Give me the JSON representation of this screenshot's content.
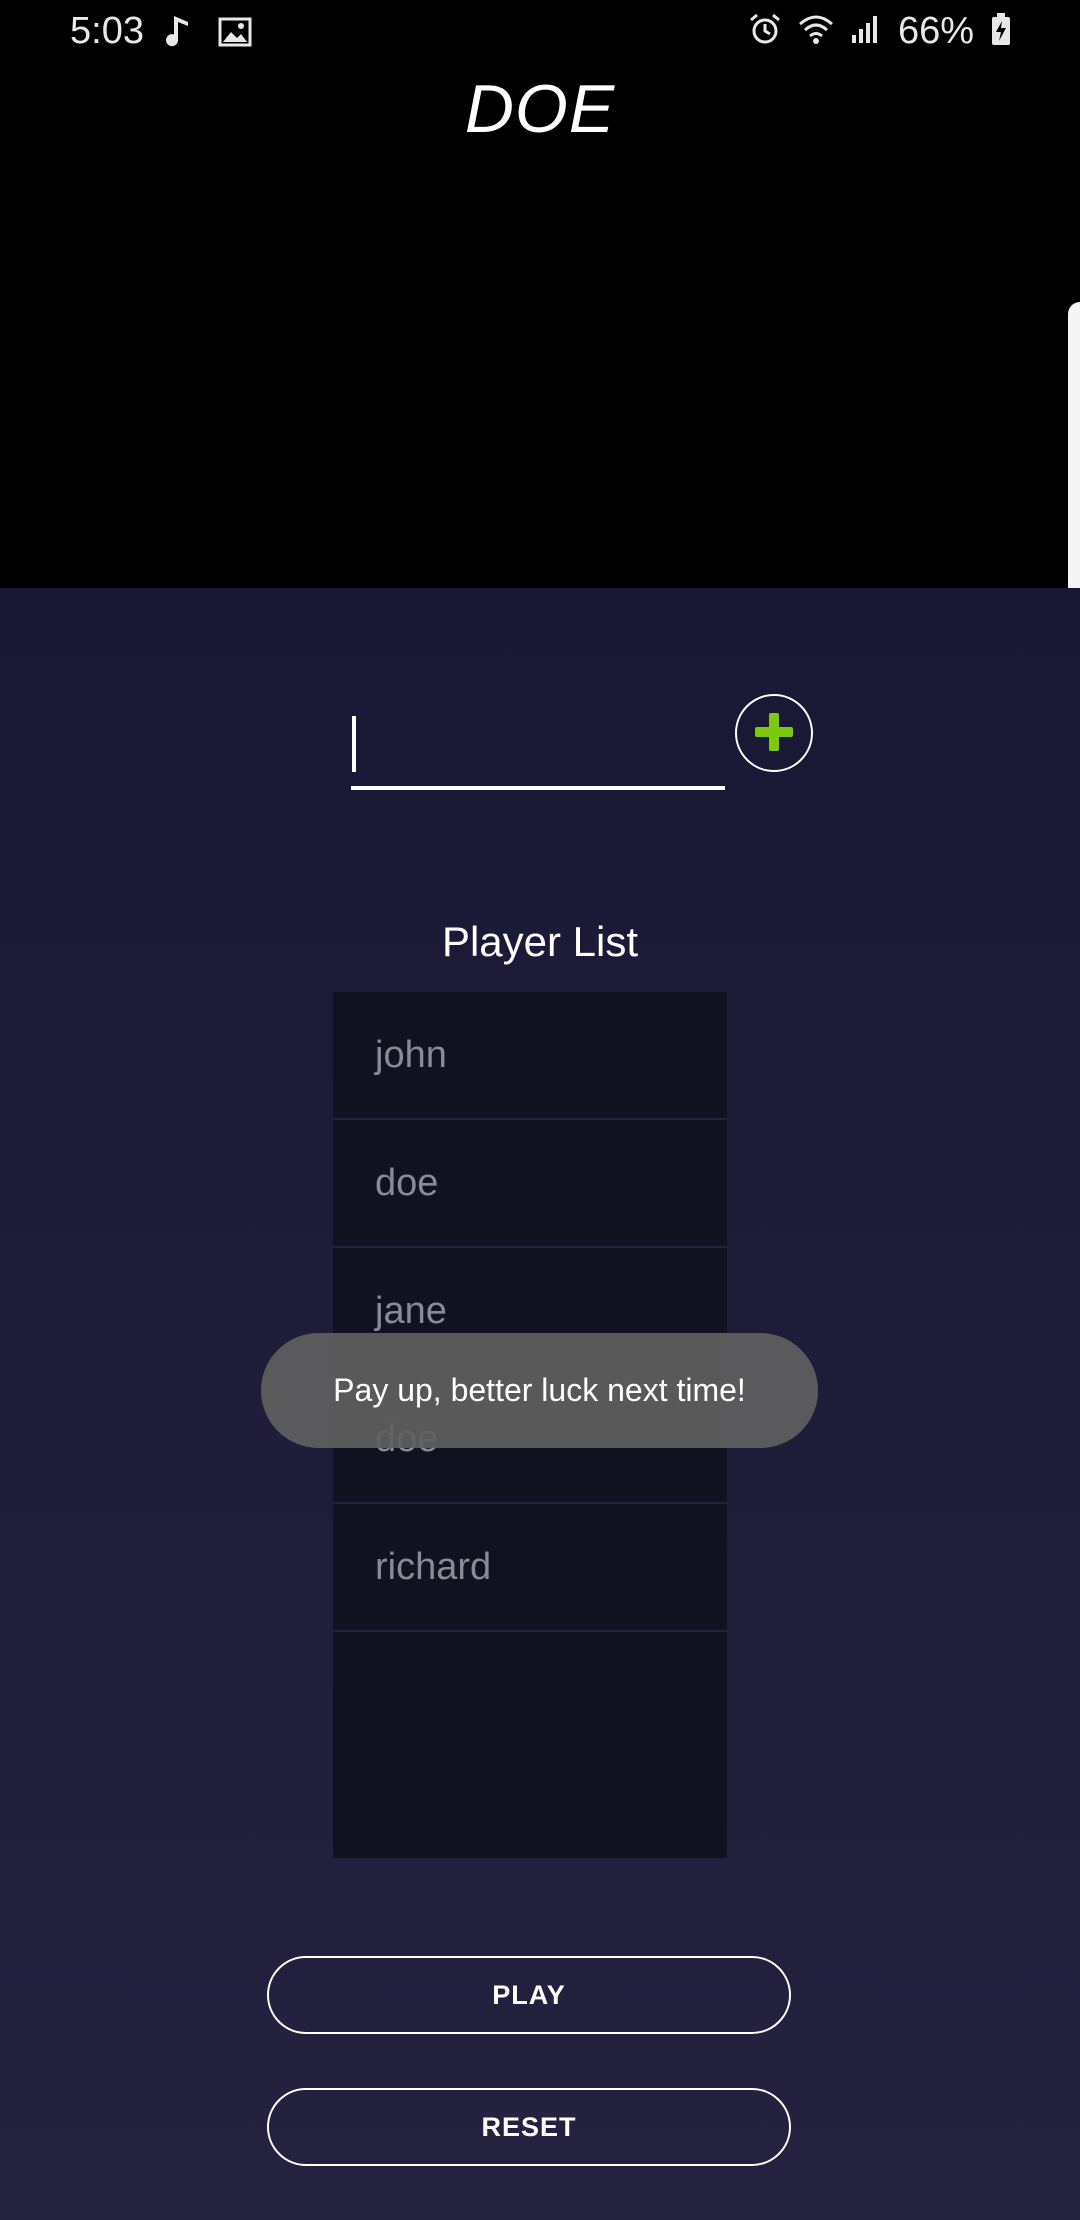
{
  "status_bar": {
    "time": "5:03",
    "battery_percent": "66%",
    "left_icons": [
      "music-note-icon",
      "image-icon"
    ],
    "right_icons": [
      "alarm-icon",
      "wifi-icon",
      "signal-icon",
      "battery-charging-icon"
    ]
  },
  "header": {
    "title": "DOE"
  },
  "input": {
    "value": "",
    "add_icon": "plus-icon",
    "add_icon_color": "#7cc90e"
  },
  "player_list": {
    "title": "Player List",
    "players": [
      "john",
      "doe",
      "jane",
      "doe",
      "richard"
    ]
  },
  "toast": {
    "message": "Pay up, better luck next time!"
  },
  "buttons": {
    "play_label": "PLAY",
    "reset_label": "RESET"
  },
  "colors": {
    "background_top": "#000000",
    "background_bottom": "#1c1b38",
    "list_bg": "#11111f"
  }
}
